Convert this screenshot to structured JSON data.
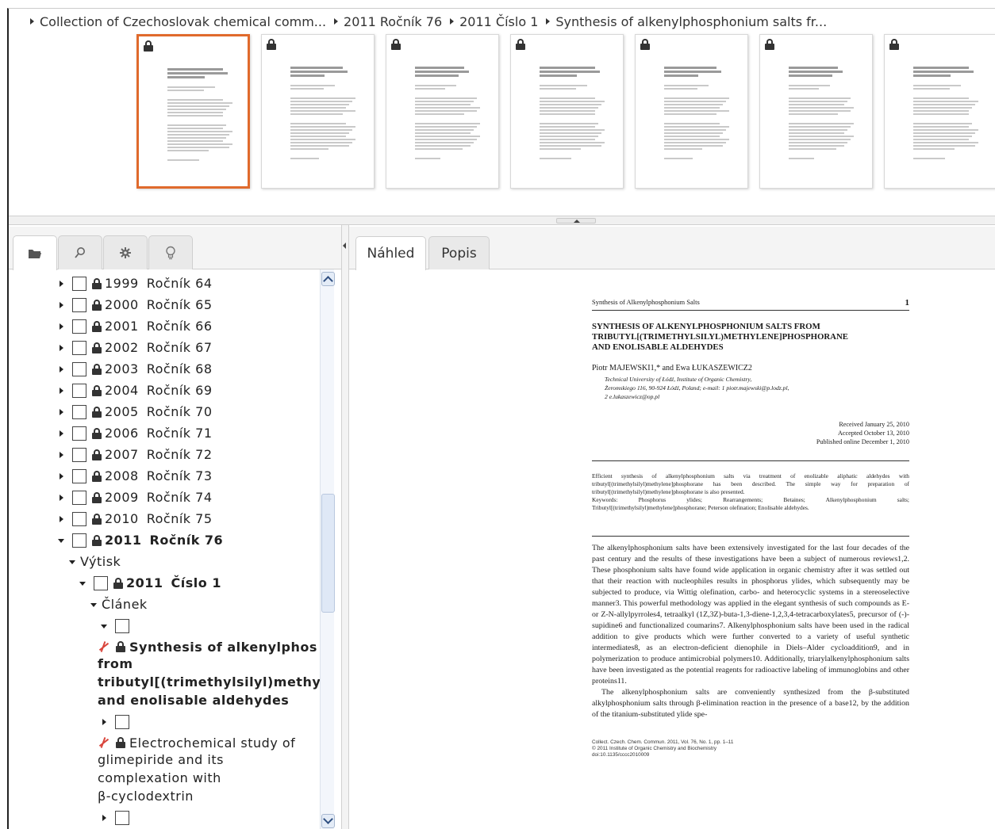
{
  "breadcrumb": [
    "Collection of Czechoslovak chemical comm...",
    "2011 Ročník 76",
    "2011 Číslo 1",
    "Synthesis of alkenylphosphonium salts fr..."
  ],
  "accent_color": "#e06a2c",
  "thumbnails_count": 7,
  "left_tabs": [
    {
      "icon": "folder-icon"
    },
    {
      "icon": "search-icon"
    },
    {
      "icon": "gear-icon"
    },
    {
      "icon": "lightbulb-icon"
    }
  ],
  "tree": {
    "years": [
      {
        "year": "1999",
        "label": "Ročník 64"
      },
      {
        "year": "2000",
        "label": "Ročník 65"
      },
      {
        "year": "2001",
        "label": "Ročník 66"
      },
      {
        "year": "2002",
        "label": "Ročník 67"
      },
      {
        "year": "2003",
        "label": "Ročník 68"
      },
      {
        "year": "2004",
        "label": "Ročník 69"
      },
      {
        "year": "2005",
        "label": "Ročník 70"
      },
      {
        "year": "2006",
        "label": "Ročník 71"
      },
      {
        "year": "2007",
        "label": "Ročník 72"
      },
      {
        "year": "2008",
        "label": "Ročník 73"
      },
      {
        "year": "2009",
        "label": "Ročník 74"
      },
      {
        "year": "2010",
        "label": "Ročník 75"
      }
    ],
    "expanded_year": {
      "year": "2011",
      "label": "Ročník 76"
    },
    "vytisk_label": "Výtisk",
    "issue": {
      "year": "2011",
      "label": "Číslo 1"
    },
    "clanek_label": "Článek",
    "articles": [
      {
        "lines": [
          "Synthesis of alkenylphos",
          "from",
          "tributyl[(trimethylsilyl)methy",
          "and enolisable aldehydes"
        ]
      },
      {
        "lines": [
          "Electrochemical study of",
          "glimepiride and its",
          "complexation with",
          "β-cyclodextrin"
        ]
      }
    ]
  },
  "right_tabs": [
    "Náhled",
    "Popis"
  ],
  "preview": {
    "running_head": "Synthesis of Alkenylphosphonium Salts",
    "page_number": "1",
    "title_lines": [
      "SYNTHESIS OF ALKENYLPHOSPHONIUM SALTS FROM",
      "TRIBUTYL[(TRIMETHYLSILYL)METHYLENE]PHOSPHORANE",
      "AND ENOLISABLE ALDEHYDES"
    ],
    "authors": "Piotr MAJEWSKI1,* and Ewa ŁUKASZEWICZ2",
    "affiliation_lines": [
      "Technical University of Łódź, Institute of Organic Chemistry,",
      "Żeromskiego 116, 90-924 Łódź, Poland; e-mail: 1 piotr.majewski@p.lodz.pl,",
      "2 e.lukaszewicz@op.pl"
    ],
    "dates": [
      "Received January 25, 2010",
      "Accepted October 13, 2010",
      "Published online December 1, 2010"
    ],
    "abstract": "Efficient synthesis of alkenylphosphonium salts via treatment of enolizable aliphatic aldehydes with tributyl[(trimethylsilyl)methylene]phosphorane has been described. The simple way for preparation of tributyl[(trimethylsilyl)methylene]phosphorane is also presented.",
    "keywords": "Keywords: Phosphorus ylides; Rearrangements; Betaines; Alkenylphosphonium salts; Tributyl[(trimethylsilyl)methylene]phosphorane; Peterson olefination; Enolisable aldehydes.",
    "body_p1": "The alkenylphosphonium salts have been extensively investigated for the last four decades of the past century and the results of these investigations have been a subject of numerous reviews1,2. These phosphonium salts have found wide application in organic chemistry after it was settled out that their reaction with nucleophiles results in phosphorus ylides, which subsequently may be subjected to produce, via Wittig olefination, carbo- and heterocyclic systems in a stereoselective manner3. This powerful methodology was applied in the elegant synthesis of such compounds as E- or Z-N-allylpyrroles4, tetraalkyl (1Z,3Z)-buta-1,3-diene-1,2,3,4-tetracarboxylates5, precursor of (-)-supidine6 and functionalized coumarins7. Alkenylphosphonium salts have been used in the radical addition to give products which were further converted to a variety of useful synthetic intermediates8, as an electron-deficient dienophile in Diels–Alder cycloaddition9, and in polymerization to produce antimicrobial polymers10. Additionally, triarylalkenylphosphonium salts have been investigated as the potential reagents for radioactive labeling of immunoglobins and other proteins11.",
    "body_p2": "The alkenylphosphonium salts are conveniently synthesized from the β-substituted alkylphosphonium salts through β-elimination reaction in the presence of a base12, by the addition of the titanium-substituted ylide spe-",
    "footer_lines": [
      "Collect. Czech. Chem. Commun. 2011, Vol. 76, No. 1, pp. 1–11",
      "© 2011 Institute of Organic Chemistry and Biochemistry",
      "doi:10.1135/cccc2010009"
    ]
  }
}
